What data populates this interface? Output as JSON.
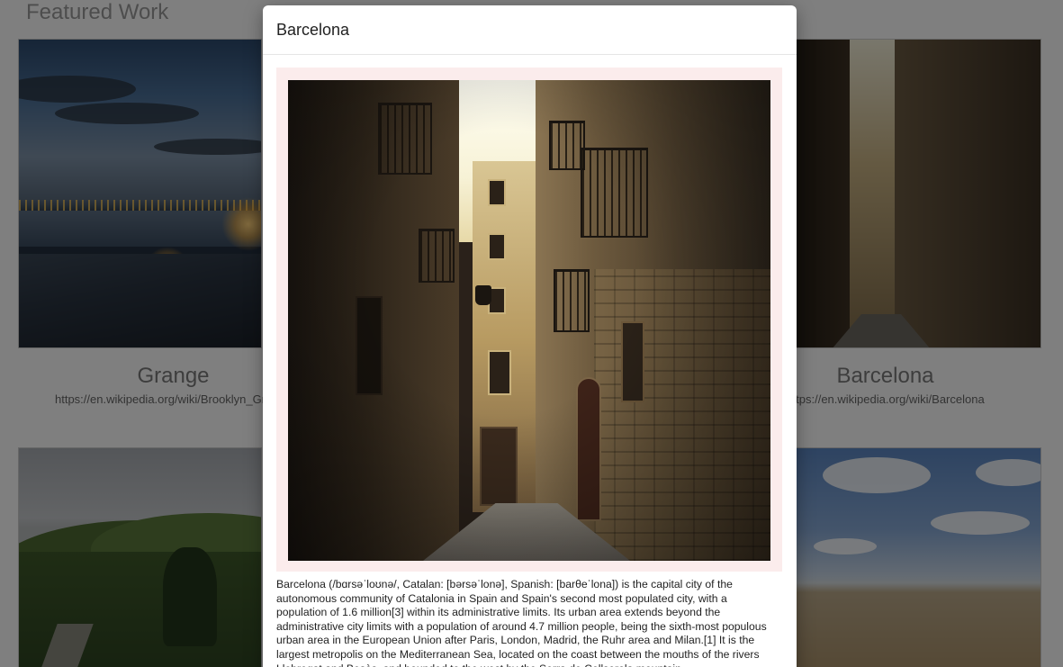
{
  "page": {
    "heading": "Featured Work"
  },
  "cards": [
    {
      "title": "Grange",
      "link": "https://en.wikipedia.org/wiki/Brooklyn_Grange"
    },
    {
      "title": "Barcelona",
      "link": "https://en.wikipedia.org/wiki/Barcelona"
    }
  ],
  "modal": {
    "title": "Barcelona",
    "description": "Barcelona (/bɑrsəˈloʊnə/, Catalan: [bərsəˈlonə], Spanish: [barθeˈlona]) is the capital city of the autonomous community of Catalonia in Spain and Spain's second most populated city, with a population of 1.6 million[3] within its administrative limits. Its urban area extends beyond the administrative city limits with a population of around 4.7 million people, being the sixth-most populous urban area in the European Union after Paris, London, Madrid, the Ruhr area and Milan.[1] It is the largest metropolis on the Mediterranean Sea, located on the coast between the mouths of the rivers Llobregat and Besòs, and bounded to the west by the Serra de Collserola mountain"
  }
}
